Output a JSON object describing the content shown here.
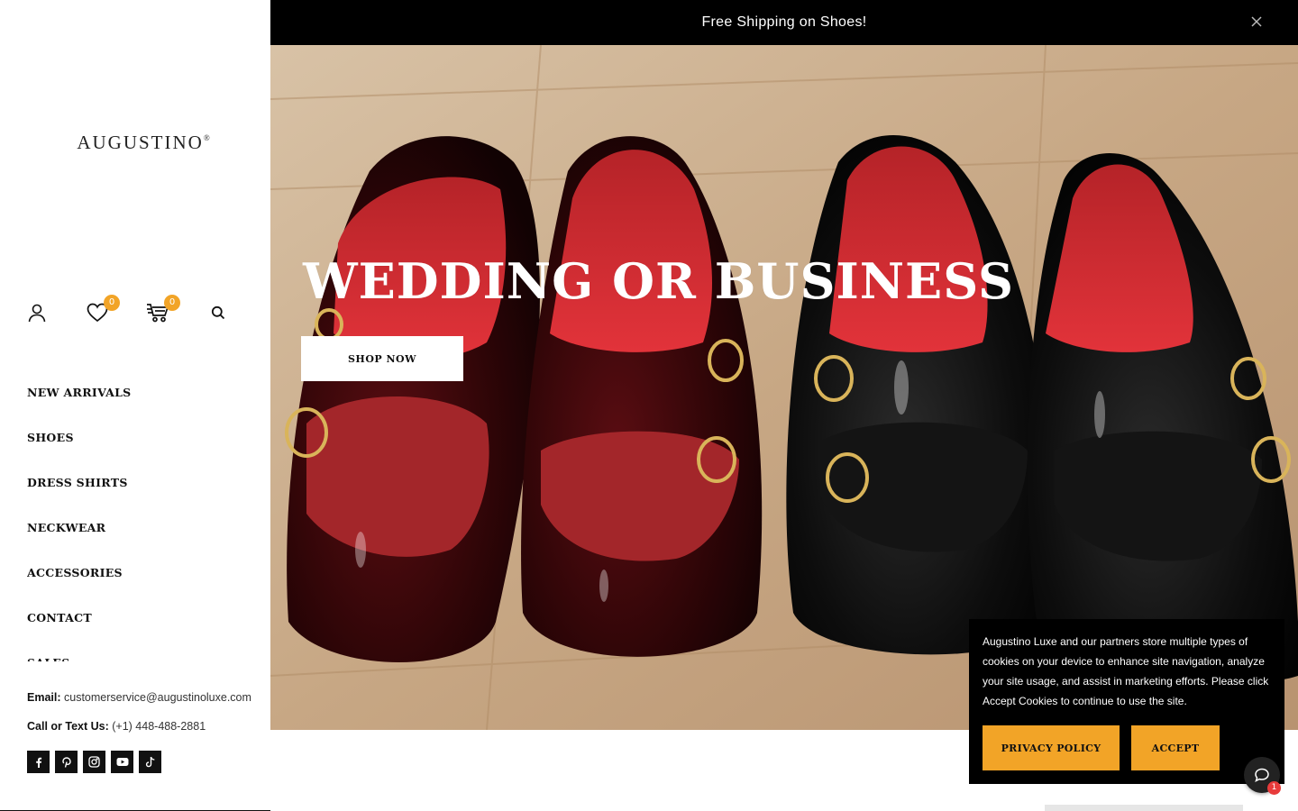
{
  "brand": {
    "name": "AUGUSTINO",
    "mark": "®"
  },
  "topbar": {
    "message": "Free Shipping on Shoes!",
    "close_icon": "close-icon"
  },
  "header_icons": {
    "account_icon": "user-icon",
    "wishlist_icon": "heart-icon",
    "wishlist_count": "0",
    "cart_icon": "cart-icon",
    "cart_count": "0",
    "search_icon": "search-icon"
  },
  "nav": {
    "items": [
      {
        "label": "NEW ARRIVALS"
      },
      {
        "label": "SHOES"
      },
      {
        "label": "DRESS SHIRTS"
      },
      {
        "label": "NECKWEAR"
      },
      {
        "label": "ACCESSORIES"
      },
      {
        "label": "CONTACT"
      },
      {
        "label": "SALES"
      }
    ]
  },
  "contact": {
    "email_label": "Email:",
    "email": "customerservice@augustinoluxe.com",
    "phone_label": "Call or Text Us:",
    "phone": "(+1) 448-488-2881"
  },
  "social": [
    "facebook-icon",
    "pinterest-icon",
    "instagram-icon",
    "youtube-icon",
    "tiktok-icon"
  ],
  "hero": {
    "title": "WEDDING OR BUSINESS",
    "button": "SHOP NOW"
  },
  "cookie": {
    "text": "Augustino Luxe and our partners store multiple types of cookies on your device to enhance site navigation, analyze your site usage, and assist in marketing efforts. Please click Accept Cookies to continue to use the site.",
    "privacy_button": "PRIVACY POLICY",
    "accept_button": "ACCEPT"
  },
  "chat": {
    "icon": "chat-icon",
    "badge": "1"
  },
  "colors": {
    "accent": "#f2a427",
    "black": "#000000",
    "white": "#ffffff"
  }
}
